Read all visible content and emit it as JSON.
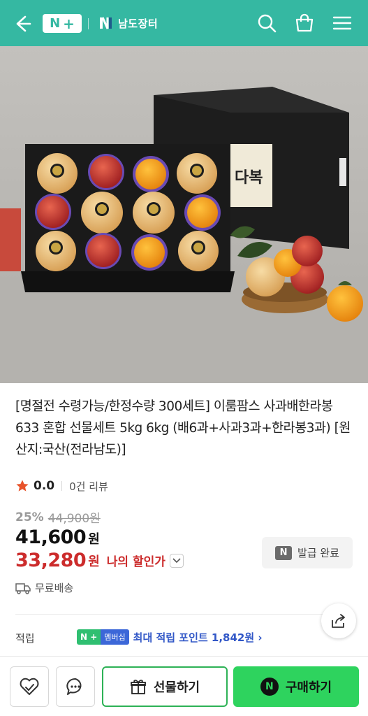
{
  "header": {
    "logo_n": "N",
    "logo_plus": "+",
    "store_name": "남도장터",
    "icons": [
      "back-arrow-icon",
      "search-icon",
      "shopping-bag-icon",
      "menu-icon"
    ]
  },
  "product": {
    "title": "[명절전 수령가능/한정수량 300세트] 이룸팜스 사과배한라봉 633 혼합 선물세트 5kg 6kg (배6과+사과3과+한라봉3과) [원산지:국산(전라남도)]",
    "box_label": "다복",
    "rating": "0.0",
    "review_count": "0건 리뷰",
    "discount_rate": "25%",
    "original_price": "44,900원",
    "price": "41,600",
    "price_unit": "원",
    "my_sale_price": "33,280",
    "my_sale_unit": "원",
    "my_sale_label": "나의 할인가",
    "coupon_n": "N",
    "coupon_label": "발급 완료",
    "shipping": "무료배송"
  },
  "points": {
    "label": "적립",
    "badge_nplus": "N +",
    "badge_membership": "멤버십",
    "text": "최대 적립 포인트 1,842원 ›"
  },
  "bottom_bar": {
    "gift_label": "선물하기",
    "buy_n": "N",
    "buy_label": "구매하기",
    "icons": [
      "wishlist-heart-icon",
      "chat-bubble-icon",
      "gift-icon"
    ]
  },
  "colors": {
    "header_bg": "#35b8a2",
    "sale_red": "#cc2c2c",
    "points_blue": "#3157c7",
    "buy_green": "#2ed35e",
    "gift_border": "#2db256"
  }
}
